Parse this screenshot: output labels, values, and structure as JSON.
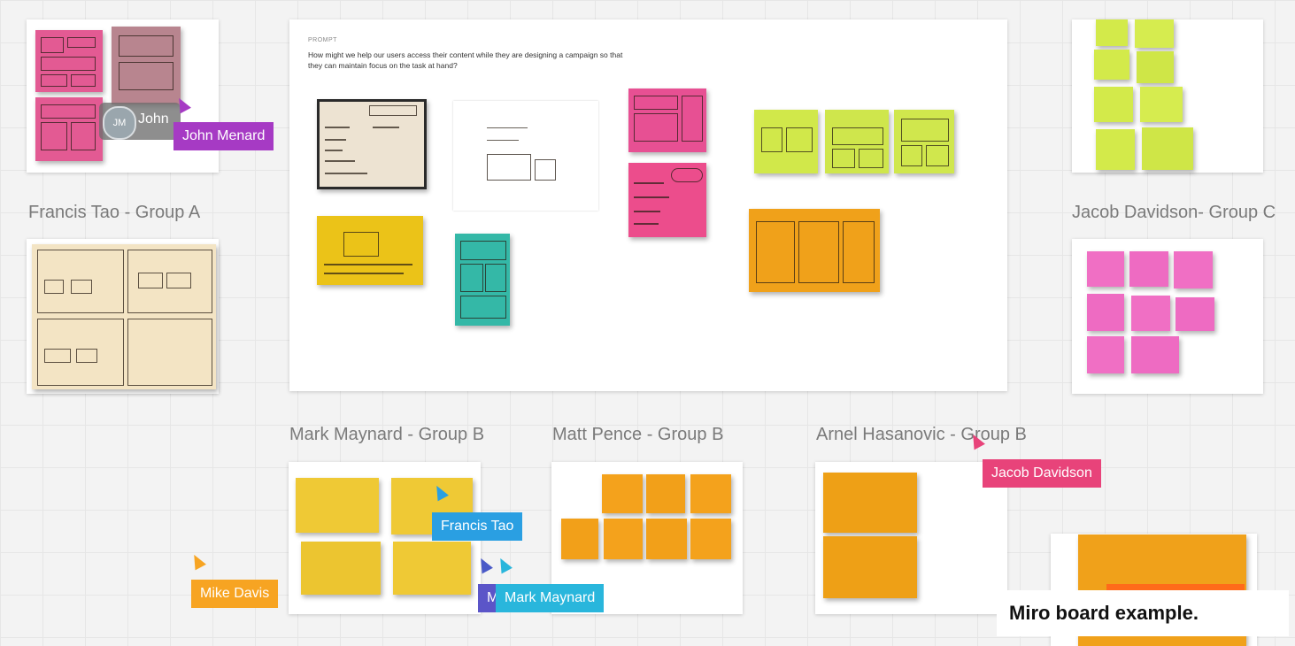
{
  "board": {
    "prompt_header": "PROMPT",
    "prompt_text": "How might we help our users access their content while they are designing a campaign so that they can maintain focus on the task at hand?"
  },
  "groups": {
    "francis": "Francis Tao - Group A",
    "jacob": "Jacob Davidson- Group C",
    "mark": "Mark Maynard  - Group B",
    "matt": "Matt Pence - Group B",
    "arnel": "Arnel Hasanovic  - Group B"
  },
  "cursors": {
    "john_menard": "John Menard",
    "jacob_davidson": "Jacob Davidson",
    "francis_tao": "Francis Tao",
    "mike_davis": "Mike Davis",
    "mark_maynard": "Mark Maynard",
    "hidden_initial": "M"
  },
  "avatar": {
    "initials": "JM",
    "name": "John"
  },
  "caption": "Miro board example.",
  "colors": {
    "pink": "#ea5a9b",
    "magenta": "#f06fc4",
    "lime": "#d3ea4a",
    "yellow": "#f2d233",
    "orange": "#f4a21c",
    "teal": "#3bbfae",
    "purple_cursor": "#a63ac4",
    "pink_cursor": "#e8437a",
    "blue_cursor": "#2a9fe2",
    "orange_cursor": "#f7a422",
    "cyan_cursor": "#29b6dc"
  }
}
